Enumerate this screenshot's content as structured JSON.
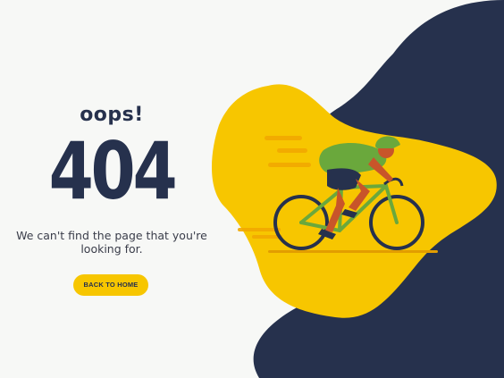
{
  "error": {
    "heading": "oops!",
    "code": "404",
    "message": "We can't find the page that you're looking for.",
    "button_label": "BACK TO HOME"
  },
  "colors": {
    "navy": "#26314d",
    "yellow": "#f7c600",
    "background": "#f7f8f6"
  },
  "illustration": {
    "icon": "cyclist-on-bicycle-illustration"
  }
}
